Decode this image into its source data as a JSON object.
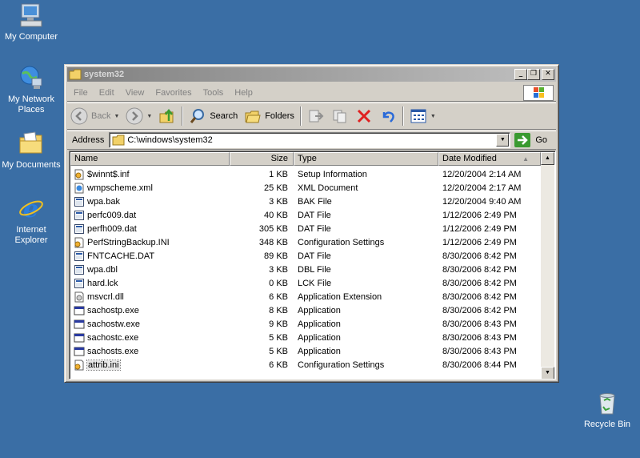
{
  "desktop": {
    "icons": [
      {
        "label": "My Computer"
      },
      {
        "label": "My Network Places"
      },
      {
        "label": "My Documents"
      },
      {
        "label": "Internet Explorer"
      },
      {
        "label": "Recycle Bin"
      }
    ]
  },
  "window": {
    "title": "system32",
    "buttons": {
      "minimize": "_",
      "maximize": "❐",
      "close": "✕"
    }
  },
  "menu": [
    "File",
    "Edit",
    "View",
    "Favorites",
    "Tools",
    "Help"
  ],
  "toolbar": {
    "back": "Back",
    "search": "Search",
    "folders": "Folders"
  },
  "address": {
    "label": "Address",
    "value": "C:\\windows\\system32",
    "go": "Go"
  },
  "list": {
    "columns": {
      "name": "Name",
      "size": "Size",
      "type": "Type",
      "date": "Date Modified"
    },
    "files": [
      {
        "name": "$winnt$.inf",
        "size": "1 KB",
        "type": "Setup Information",
        "date": "12/20/2004 2:14 AM",
        "icon": "inf-icon"
      },
      {
        "name": "wmpscheme.xml",
        "size": "25 KB",
        "type": "XML Document",
        "date": "12/20/2004 2:17 AM",
        "icon": "xml-icon"
      },
      {
        "name": "wpa.bak",
        "size": "3 KB",
        "type": "BAK File",
        "date": "12/20/2004 9:40 AM",
        "icon": "generic-file-icon"
      },
      {
        "name": "perfc009.dat",
        "size": "40 KB",
        "type": "DAT File",
        "date": "1/12/2006 2:49 PM",
        "icon": "generic-file-icon"
      },
      {
        "name": "perfh009.dat",
        "size": "305 KB",
        "type": "DAT File",
        "date": "1/12/2006 2:49 PM",
        "icon": "generic-file-icon"
      },
      {
        "name": "PerfStringBackup.INI",
        "size": "348 KB",
        "type": "Configuration Settings",
        "date": "1/12/2006 2:49 PM",
        "icon": "ini-icon"
      },
      {
        "name": "FNTCACHE.DAT",
        "size": "89 KB",
        "type": "DAT File",
        "date": "8/30/2006 8:42 PM",
        "icon": "generic-file-icon"
      },
      {
        "name": "wpa.dbl",
        "size": "3 KB",
        "type": "DBL File",
        "date": "8/30/2006 8:42 PM",
        "icon": "generic-file-icon"
      },
      {
        "name": "hard.lck",
        "size": "0 KB",
        "type": "LCK File",
        "date": "8/30/2006 8:42 PM",
        "icon": "generic-file-icon"
      },
      {
        "name": "msvcrl.dll",
        "size": "6 KB",
        "type": "Application Extension",
        "date": "8/30/2006 8:42 PM",
        "icon": "dll-icon"
      },
      {
        "name": "sachostp.exe",
        "size": "8 KB",
        "type": "Application",
        "date": "8/30/2006 8:42 PM",
        "icon": "exe-icon"
      },
      {
        "name": "sachostw.exe",
        "size": "9 KB",
        "type": "Application",
        "date": "8/30/2006 8:43 PM",
        "icon": "exe-icon"
      },
      {
        "name": "sachostc.exe",
        "size": "5 KB",
        "type": "Application",
        "date": "8/30/2006 8:43 PM",
        "icon": "exe-icon"
      },
      {
        "name": "sachosts.exe",
        "size": "5 KB",
        "type": "Application",
        "date": "8/30/2006 8:43 PM",
        "icon": "exe-icon"
      },
      {
        "name": "attrib.ini",
        "size": "6 KB",
        "type": "Configuration Settings",
        "date": "8/30/2006 8:44 PM",
        "icon": "ini-icon",
        "selected": true
      }
    ]
  }
}
